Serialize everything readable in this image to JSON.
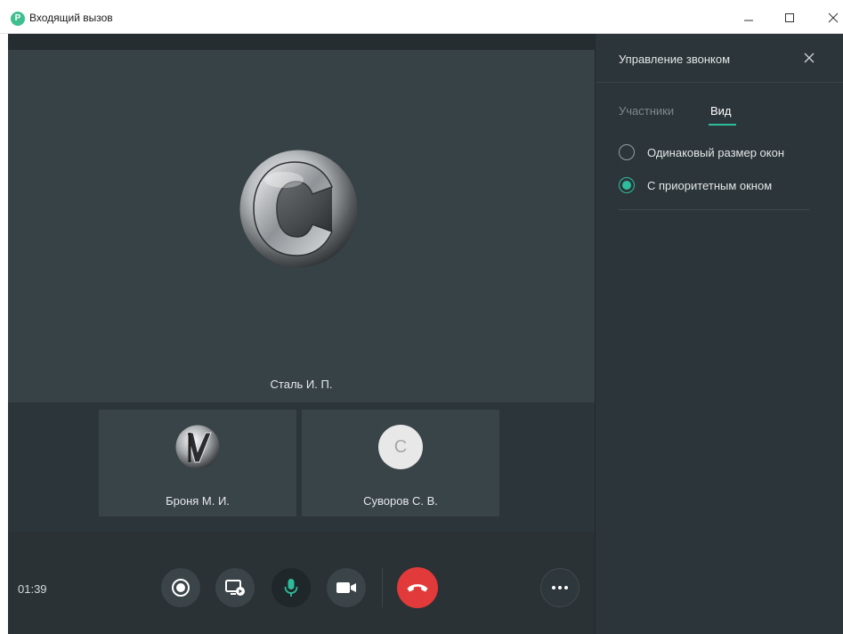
{
  "window": {
    "title": "Входящий вызов",
    "app_icon_letter": "P",
    "app_icon_color": "#3fbf8f"
  },
  "call": {
    "main_participant": "Сталь И. П.",
    "participants": [
      {
        "name": "Броня М. И.",
        "avatar": "logo-v"
      },
      {
        "name": "Суворов С. В.",
        "avatar_letter": "C"
      }
    ],
    "timer": "01:39"
  },
  "controls": {
    "record": "record-icon",
    "screen_share": "screen-share-icon",
    "microphone": "microphone-icon",
    "camera": "camera-icon",
    "hangup": "hangup-icon",
    "more": "more-icon",
    "hangup_color": "#e23a3a",
    "accent_color": "#2ebd9c"
  },
  "panel": {
    "title": "Управление звонком",
    "tabs": [
      {
        "label": "Участники",
        "active": false
      },
      {
        "label": "Вид",
        "active": true
      }
    ],
    "options": [
      {
        "label": "Одинаковый размер окон",
        "selected": false
      },
      {
        "label": "С приоритетным окном",
        "selected": true
      }
    ]
  }
}
